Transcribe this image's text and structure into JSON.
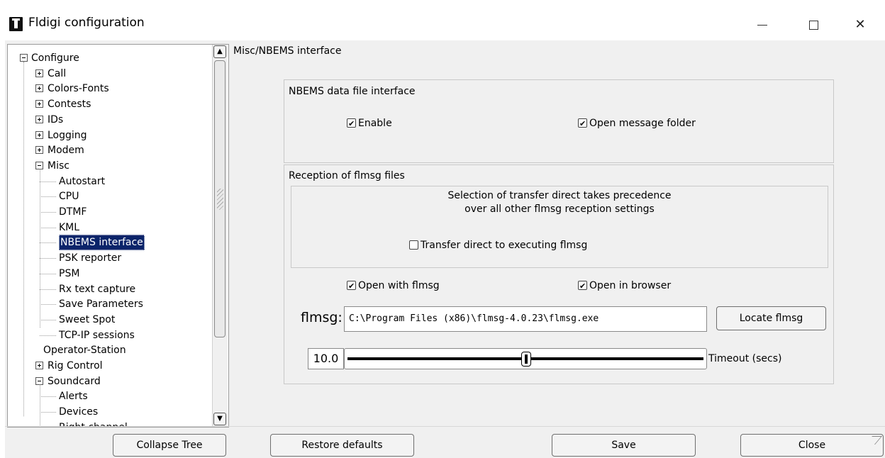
{
  "window": {
    "title": "Fldigi configuration",
    "minimize_label": "",
    "maximize_label": "",
    "close_label": "✕"
  },
  "tree": {
    "items": [
      {
        "label": "Configure",
        "level": 0,
        "toggle": "minus"
      },
      {
        "label": "Call",
        "level": 1,
        "toggle": "plus"
      },
      {
        "label": "Colors-Fonts",
        "level": 1,
        "toggle": "plus"
      },
      {
        "label": "Contests",
        "level": 1,
        "toggle": "plus"
      },
      {
        "label": "IDs",
        "level": 1,
        "toggle": "plus"
      },
      {
        "label": "Logging",
        "level": 1,
        "toggle": "plus"
      },
      {
        "label": "Modem",
        "level": 1,
        "toggle": "plus"
      },
      {
        "label": "Misc",
        "level": 1,
        "toggle": "minus"
      },
      {
        "label": "Autostart",
        "level": 2
      },
      {
        "label": "CPU",
        "level": 2
      },
      {
        "label": "DTMF",
        "level": 2
      },
      {
        "label": "KML",
        "level": 2
      },
      {
        "label": "NBEMS interface",
        "level": 2,
        "selected": true
      },
      {
        "label": "PSK reporter",
        "level": 2
      },
      {
        "label": "PSM",
        "level": 2
      },
      {
        "label": "Rx text capture",
        "level": 2
      },
      {
        "label": "Save Parameters",
        "level": 2
      },
      {
        "label": "Sweet Spot",
        "level": 2
      },
      {
        "label": "TCP-IP sessions",
        "level": 2
      },
      {
        "label": "Operator-Station",
        "level": 1
      },
      {
        "label": "Rig Control",
        "level": 1,
        "toggle": "plus"
      },
      {
        "label": "Soundcard",
        "level": 1,
        "toggle": "minus"
      },
      {
        "label": "Alerts",
        "level": 2
      },
      {
        "label": "Devices",
        "level": 2
      },
      {
        "label": "Right channel",
        "level": 2
      }
    ],
    "scroll_up": "▲",
    "scroll_down": "▼"
  },
  "panel": {
    "title": "Misc/NBEMS interface",
    "data_file_group": {
      "label": "NBEMS data file interface",
      "enable": {
        "label": "Enable",
        "checked": true
      },
      "open_folder": {
        "label": "Open message folder",
        "checked": true
      }
    },
    "reception_group": {
      "label": "Reception of flmsg files",
      "note_line1": "Selection of transfer direct takes precedence",
      "note_line2": "over all other flmsg reception settings",
      "transfer_direct": {
        "label": "Transfer direct to executing flmsg",
        "checked": false
      },
      "open_with_flmsg": {
        "label": "Open with flmsg",
        "checked": true
      },
      "open_in_browser": {
        "label": "Open in browser",
        "checked": true
      },
      "flmsg_label": "flmsg:",
      "flmsg_path": "C:\\Program Files (x86)\\flmsg-4.0.23\\flmsg.exe",
      "locate_button": "Locate flmsg",
      "timeout_value": "10.0",
      "timeout_fraction": 0.5,
      "timeout_label": "Timeout (secs)"
    }
  },
  "buttons": {
    "collapse_tree": "Collapse Tree",
    "restore_defaults": "Restore defaults",
    "save": "Save",
    "close": "Close"
  }
}
